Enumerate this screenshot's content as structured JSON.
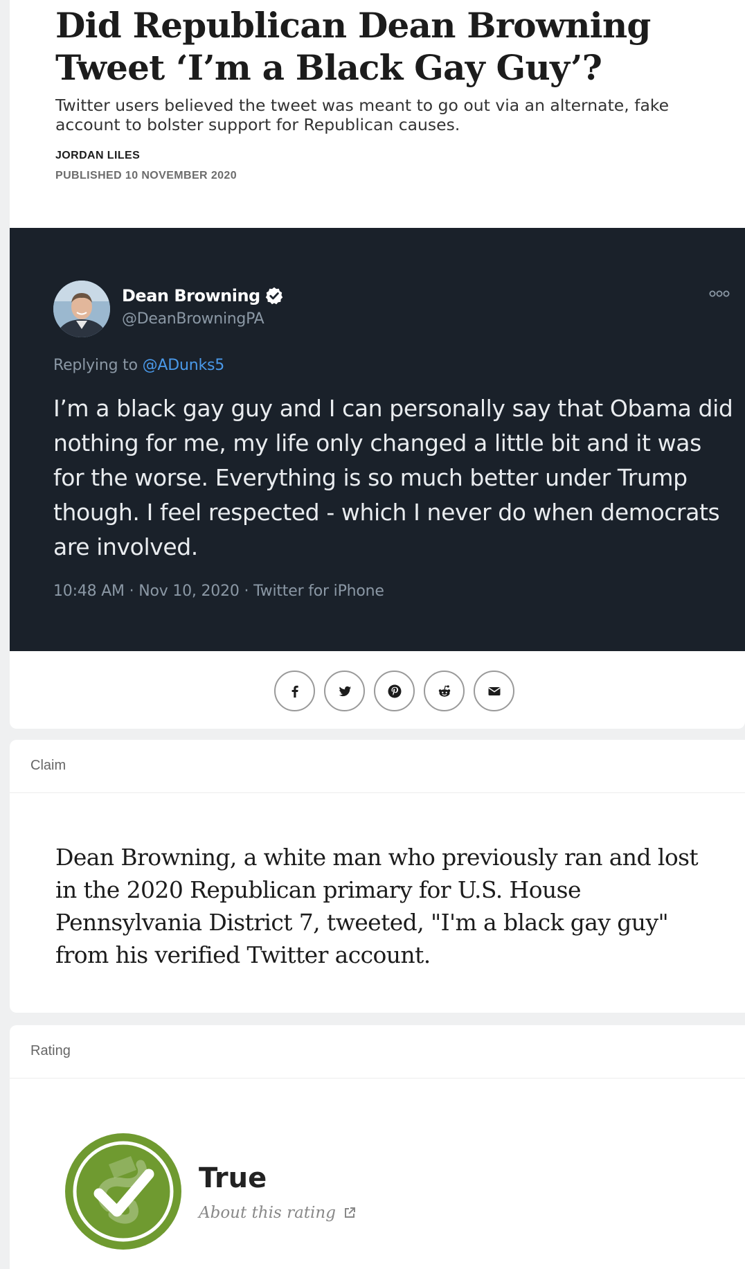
{
  "article": {
    "headline": "Did Republican Dean Browning Tweet ‘I’m a Black Gay Guy’?",
    "subtitle": "Twitter users believed the tweet was meant to go out via an alternate, fake account to bolster support for Republican causes.",
    "author": "JORDAN LILES",
    "published": "PUBLISHED 10 NOVEMBER 2020"
  },
  "tweet": {
    "name": "Dean Browning",
    "handle": "@DeanBrowningPA",
    "replying_prefix": "Replying to ",
    "replying_to": "@ADunks5",
    "text": "I’m a black gay guy and I can personally say that Obama did nothing for me, my life only changed a little bit and it was for the worse. Everything is so much better under Trump though. I feel respected - which I never do when democrats are involved.",
    "meta": "10:48 AM · Nov 10, 2020 · Twitter for iPhone"
  },
  "share": {
    "icons": [
      "facebook-icon",
      "twitter-icon",
      "pinterest-icon",
      "reddit-icon",
      "email-icon"
    ]
  },
  "claim": {
    "label": "Claim",
    "text": "Dean Browning, a white man who previously ran and lost in the 2020 Republican primary for U.S. House Pennsylvania District 7, tweeted, \"I'm a black gay guy\" from his verified Twitter account."
  },
  "rating": {
    "label": "Rating",
    "value": "True",
    "link": "About this rating",
    "badge_color": "#6f9a30"
  }
}
